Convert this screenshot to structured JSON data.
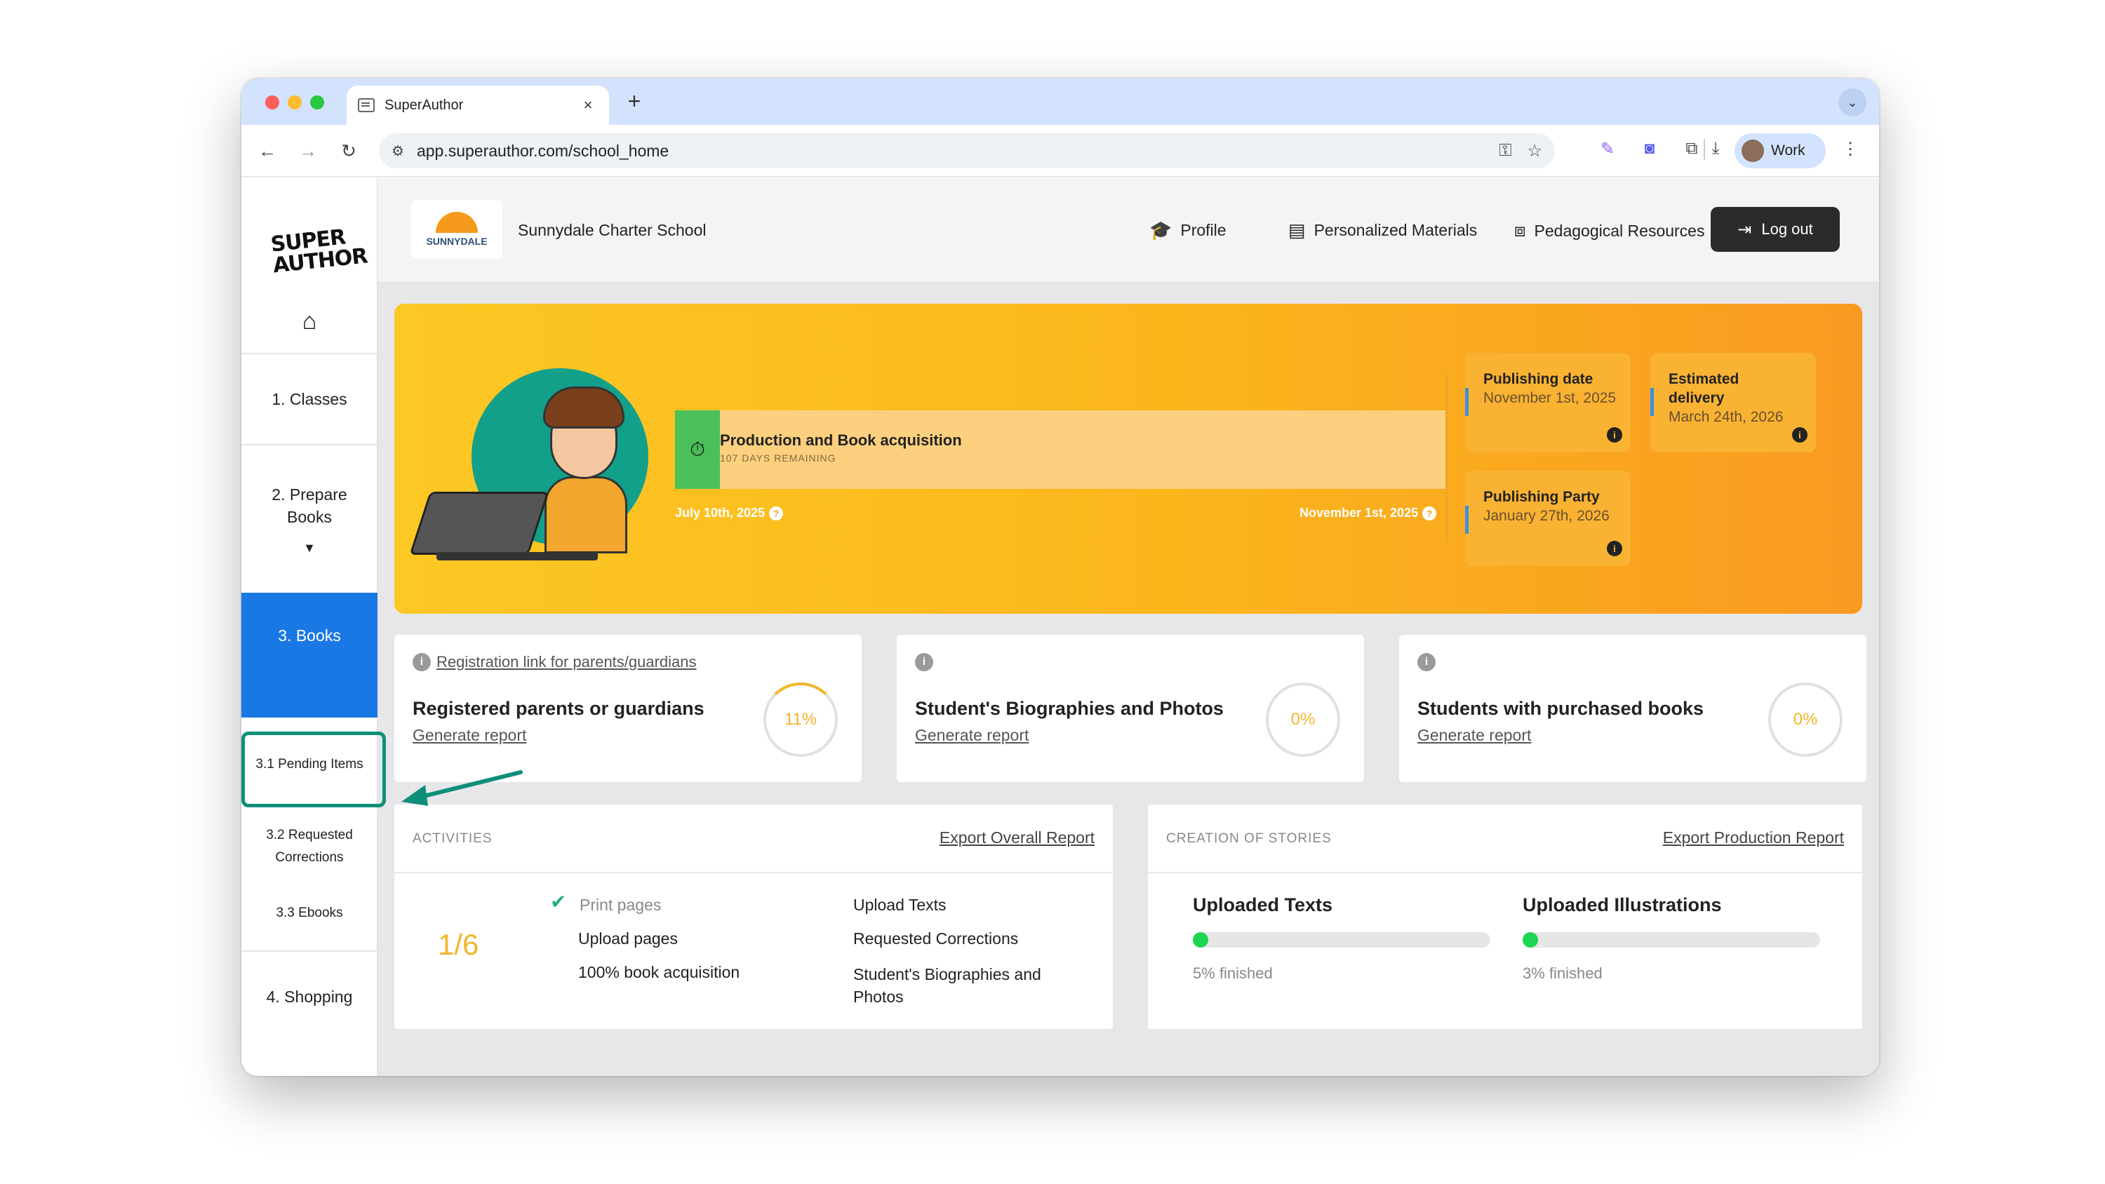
{
  "browser": {
    "tab_title": "SuperAuthor",
    "tab_close": "×",
    "new_tab": "+",
    "url": "app.superauthor.com/school_home",
    "profile_label": "Work"
  },
  "sidebar": {
    "logo_text": "SUPER AUTHOR",
    "items": [
      {
        "label": "1. Classes"
      },
      {
        "label": "2. Prepare Books"
      },
      {
        "label": "3. Books"
      },
      {
        "label": "3.1 Pending Items"
      },
      {
        "label": "3.2 Requested Corrections"
      },
      {
        "label": "3.3 Ebooks"
      },
      {
        "label": "4. Shopping"
      }
    ]
  },
  "header": {
    "school_logo_text": "SUNNYDALE",
    "school_name": "Sunnydale Charter School",
    "links": [
      {
        "label": "Profile",
        "icon": "graduation-cap-icon"
      },
      {
        "label": "Personalized Materials",
        "icon": "book-icon"
      },
      {
        "label": "Pedagogical Resources",
        "icon": "teacher-board-icon"
      }
    ],
    "logout_label": "Log out"
  },
  "banner": {
    "phase_title": "Production and Book acquisition",
    "phase_sub": "107 DAYS REMAINING",
    "start_date": "July 10th, 2025",
    "end_date": "November 1st, 2025",
    "cards": [
      {
        "label": "Publishing date",
        "value": "November 1st, 2025"
      },
      {
        "label": "Estimated delivery",
        "value": "March 24th, 2026"
      },
      {
        "label": "Publishing Party",
        "value": "January 27th, 2026"
      }
    ]
  },
  "stats": [
    {
      "link": "Registration link for parents/guardians",
      "title": "Registered parents or guardians",
      "report": "Generate report",
      "percent": "11%"
    },
    {
      "link": "",
      "title": "Student's Biographies and Photos",
      "report": "Generate report",
      "percent": "0%"
    },
    {
      "link": "",
      "title": "Students with purchased books",
      "report": "Generate report",
      "percent": "0%"
    }
  ],
  "activities": {
    "caption": "ACTIVITIES",
    "export": "Export Overall Report",
    "fraction": "1/6",
    "items_left": [
      "Print pages",
      "Upload pages",
      "100% book acquisition"
    ],
    "items_right": [
      "Upload Texts",
      "Requested Corrections",
      "Student's Biographies and Photos"
    ]
  },
  "stories": {
    "caption": "CREATION OF STORIES",
    "export": "Export Production Report",
    "texts_title": "Uploaded Texts",
    "texts_progress": "5% finished",
    "texts_fraction": 0.05,
    "illus_title": "Uploaded Illustrations",
    "illus_progress": "3% finished",
    "illus_fraction": 0.03
  }
}
